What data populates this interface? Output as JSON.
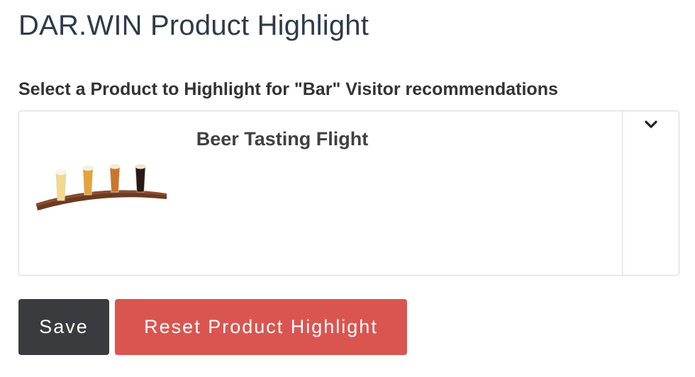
{
  "header": {
    "title": "DAR.WIN Product Highlight"
  },
  "form": {
    "select_label": "Select a Product to Highlight for \"Bar\" Visitor recommendations",
    "selected_product": {
      "name": "Beer Tasting Flight",
      "image_icon": "beer-tasting-flight-image"
    },
    "dropdown_icon": "chevron-down-icon"
  },
  "actions": {
    "save_label": "Save",
    "reset_label": "Reset Product Highlight"
  },
  "colors": {
    "title": "#2f3a4a",
    "save_button": "#393b3e",
    "reset_button": "#da5550",
    "border": "#d9d9d9"
  }
}
